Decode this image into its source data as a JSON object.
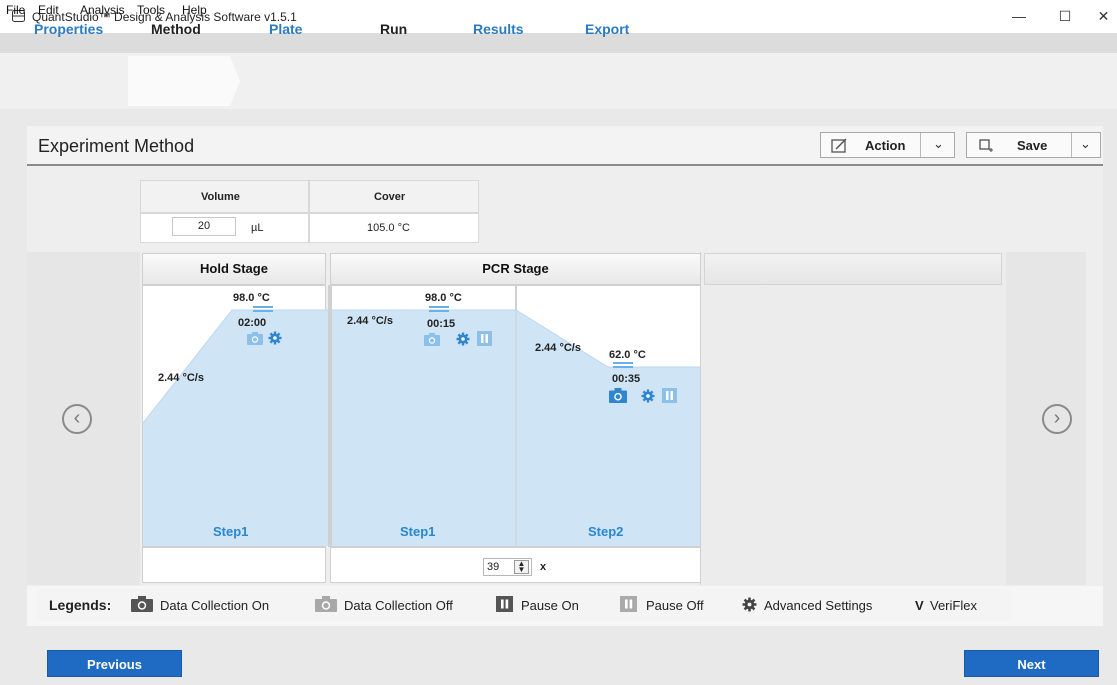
{
  "window": {
    "title": "QuantStudio™ Design & Analysis Software v1.5.1",
    "minimize": "—",
    "maximize": "☐",
    "close": "✕"
  },
  "menu": [
    "File",
    "Edit",
    "Analysis",
    "Tools",
    "Help"
  ],
  "tabs": [
    {
      "label": "Properties",
      "active": false
    },
    {
      "label": "Method",
      "active": true
    },
    {
      "label": "Plate",
      "active": false
    },
    {
      "label": "Run",
      "active": false
    },
    {
      "label": "Results",
      "active": false
    },
    {
      "label": "Export",
      "active": false
    }
  ],
  "panel": {
    "title": "Experiment Method",
    "action_label": "Action",
    "save_label": "Save"
  },
  "reaction": {
    "volume_header": "Volume",
    "cover_header": "Cover",
    "volume_value": "20",
    "volume_unit": "µL",
    "cover_value": "105.0 °C"
  },
  "stages": {
    "hold": {
      "name": "Hold Stage",
      "step": {
        "label": "Step1",
        "temp": "98.0 °C",
        "time": "02:00",
        "ramp": "2.44 °C/s"
      }
    },
    "pcr": {
      "name": "PCR Stage",
      "step1": {
        "label": "Step1",
        "temp": "98.0 °C",
        "time": "00:15",
        "ramp": "2.44 °C/s"
      },
      "step2": {
        "label": "Step2",
        "temp": "62.0 °C",
        "time": "00:35",
        "ramp": "2.44 °C/s"
      },
      "cycles": "39",
      "cycles_suffix": "x"
    }
  },
  "legend": {
    "title": "Legends:",
    "items": [
      "Data Collection On",
      "Data Collection Off",
      "Pause On",
      "Pause Off",
      "Advanced Settings",
      "VeriFlex"
    ],
    "veriflex_symbol": "V"
  },
  "footer": {
    "previous": "Previous",
    "next": "Next"
  },
  "colors": {
    "accent": "#2a7bc0",
    "button_blue": "#1f6ac2",
    "profile_fill": "#cfe4f5",
    "icon_on": "#2f86cf",
    "icon_off": "#8cc0e8"
  }
}
